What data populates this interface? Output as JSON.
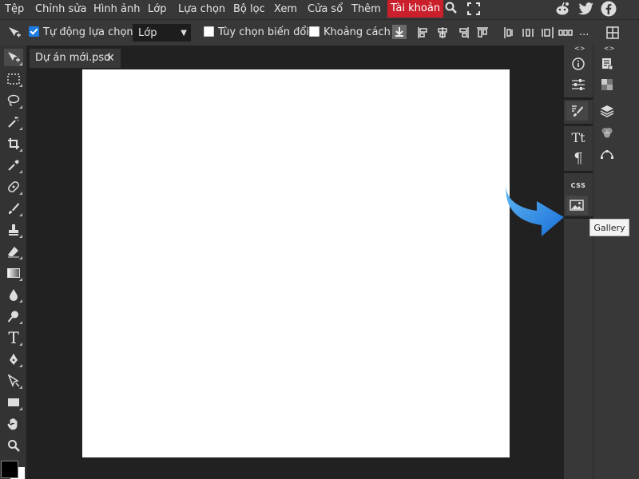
{
  "menubar": {
    "items": [
      "Tệp",
      "Chỉnh sửa",
      "Hình ảnh",
      "Lớp",
      "Lựa chọn",
      "Bộ lọc",
      "Xem",
      "Cửa sổ",
      "Thêm"
    ],
    "account": "Tài khoản"
  },
  "options": {
    "auto_select_label": "Tự động lựa chọn",
    "auto_select_checked": true,
    "layer_select_value": "Lớp",
    "transform_label": "Tùy chọn biến đổi",
    "spacing_label": "Khoảng cách",
    "more_label": "..."
  },
  "document": {
    "tab_title": "Dự án mới.psd"
  },
  "right_panel": {
    "css_label": "CSS",
    "tooltip": "Gallery",
    "collapse_left": "<>",
    "collapse_right": "<>"
  },
  "colors": {
    "accent": "#c9202c",
    "checkbox_blue": "#1e7be3",
    "arrow_blue": "#2f8fe8"
  }
}
